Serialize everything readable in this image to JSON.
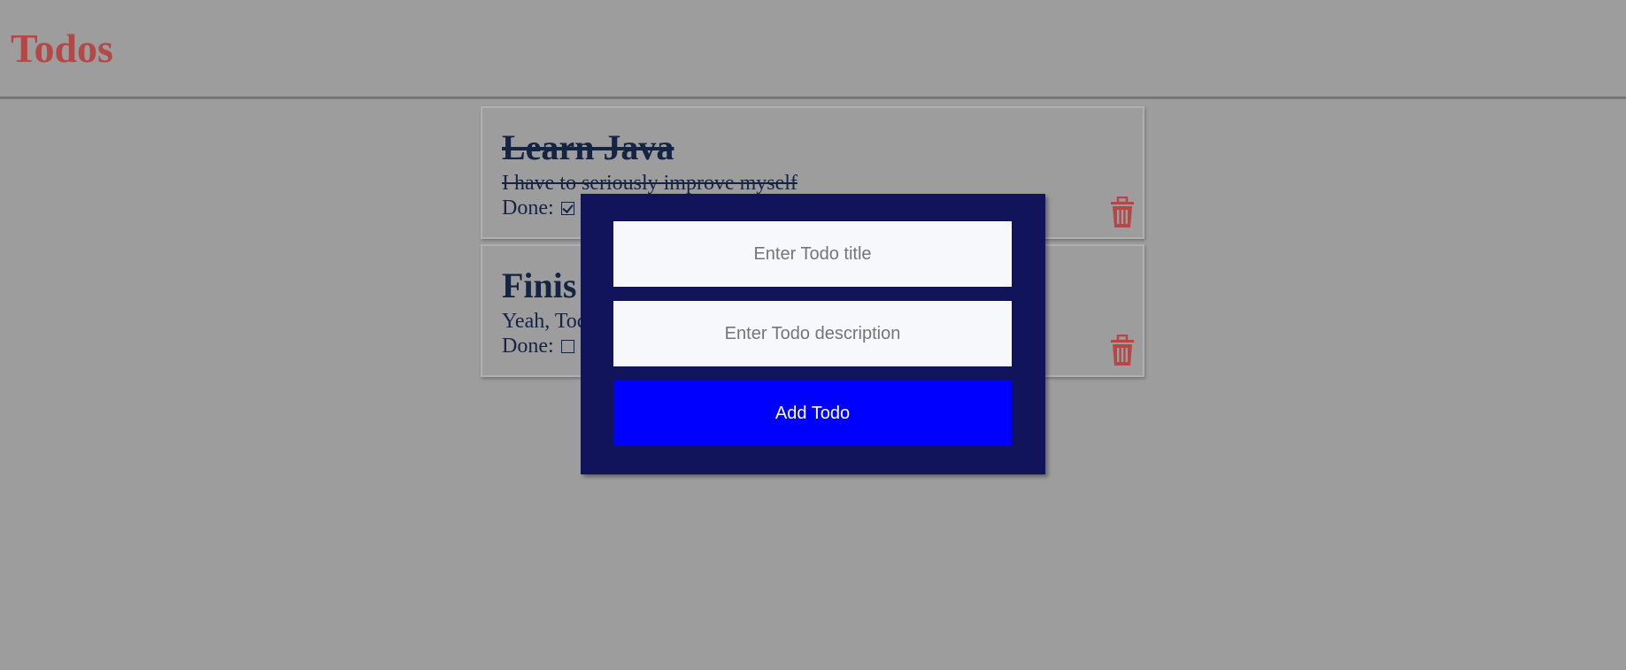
{
  "app": {
    "title": "Todos"
  },
  "todos": [
    {
      "title": "Learn Java",
      "description": "I have to seriously improve myself",
      "done_label": "Done:",
      "done": true
    },
    {
      "title": "Finis",
      "description": "Yeah, Toc",
      "done_label": "Done:",
      "done": false
    }
  ],
  "modal": {
    "title_placeholder": "Enter Todo title",
    "description_placeholder": "Enter Todo description",
    "add_button_label": "Add Todo"
  },
  "colors": {
    "background": "#9d9d9d",
    "title_red": "#b64747",
    "todo_text": "#132445",
    "modal_bg": "#11145a",
    "button_blue": "#0000ff",
    "trash_red": "#b64747"
  },
  "icons": {
    "delete": "trash-icon",
    "done_checked": "checkbox-checked",
    "done_unchecked": "checkbox-empty"
  }
}
